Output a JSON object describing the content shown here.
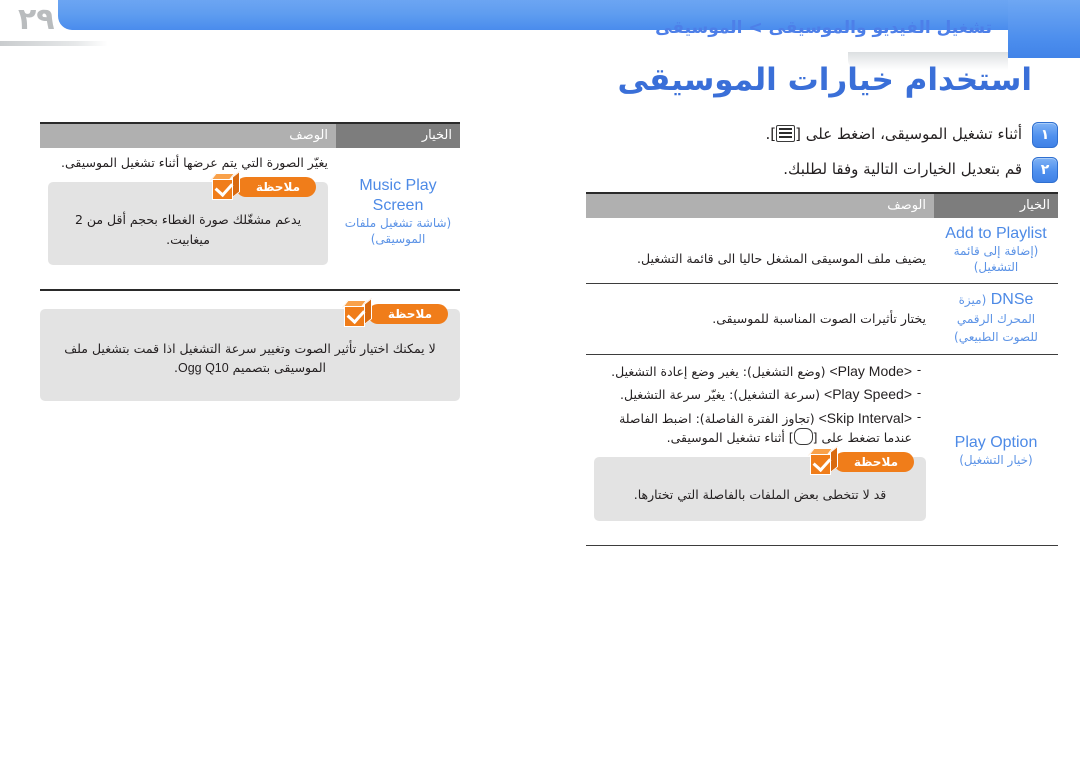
{
  "page": {
    "number": "٢٩",
    "breadcrumb": "تشغيل الفيديو والموسيقى > الموسيقى",
    "title": "استخدام خيارات الموسيقى"
  },
  "colors": {
    "banner_blue": "#5f9df0",
    "accent_blue": "#4d8ae6",
    "title_blue": "#3a6fd8",
    "note_orange": "#f07d1a",
    "header_option_gray": "#7d7d7d",
    "header_desc_gray": "#b0b0b0",
    "note_bg_gray": "#e3e3e3"
  },
  "steps": [
    {
      "badge": "١",
      "text_before": "أثناء تشغيل الموسيقى، اضغط على [",
      "key_icon": "menu-key-icon",
      "text_after": "]."
    },
    {
      "badge": "٢",
      "text_before": "قم بتعديل الخيارات التالية وفقا لطلبك.",
      "key_icon": "",
      "text_after": ""
    }
  ],
  "table_headers": {
    "option": "الخيار",
    "description": "الوصف"
  },
  "right_table": {
    "rows": [
      {
        "option_en": "Add to Playlist",
        "option_ar": "(إضافة إلى قائمة التشغيل)",
        "description": "يضيف ملف الموسيقى المشغل حاليا الى قائمة التشغيل."
      },
      {
        "option_en": "DNSe",
        "option_ar": "(ميزة المحرك الرقمي للصوت الطبيعي)",
        "description": "يختار تأثيرات الصوت المناسبة للموسيقى."
      }
    ],
    "play_option": {
      "option_en": "Play Option",
      "option_ar": "(خيار التشغيل)",
      "bullets": [
        {
          "dash": "-",
          "cmd": "<Play Mode>",
          "text": " (وضع التشغيل): يغير وضع إعادة التشغيل."
        },
        {
          "dash": "-",
          "cmd": "<Play Speed>",
          "text": " (سرعة التشغيل): يغيّر سرعة التشغيل."
        },
        {
          "dash": "-",
          "cmd": "<Skip Interval>",
          "text_a": " (تجاوز الفترة الفاصلة): اضبط الفاصلة عندما تضغط على [",
          "key_icon": "round-key-icon",
          "text_b": "] أثناء تشغيل الموسيقى."
        }
      ],
      "note": {
        "label": "ملاحظة",
        "icon": "note-check-box-icon",
        "text": "قد لا تتخطى بعض الملفات بالفاصلة التي تختارها."
      }
    }
  },
  "left_table": {
    "rows": [
      {
        "option_en": "Music Play Screen",
        "option_ar": "(شاشة تشغيل ملفات الموسيقى)",
        "description": "يغيّر الصورة التي يتم عرضها أثناء تشغيل الموسيقى.",
        "note": {
          "label": "ملاحظة",
          "icon": "note-check-box-icon",
          "text": "يدعم مشغّلك صورة الغطاء بحجم أقل من 2 ميغابيت."
        }
      }
    ],
    "bottom_note": {
      "label": "ملاحظة",
      "icon": "note-check-box-icon",
      "text_a": "لا يمكنك اختيار تأثير الصوت وتغيير سرعة التشغيل اذا قمت بتشغيل ملف الموسيقى بتصميم ",
      "text_b": "Ogg Q10",
      "text_c": "."
    }
  }
}
